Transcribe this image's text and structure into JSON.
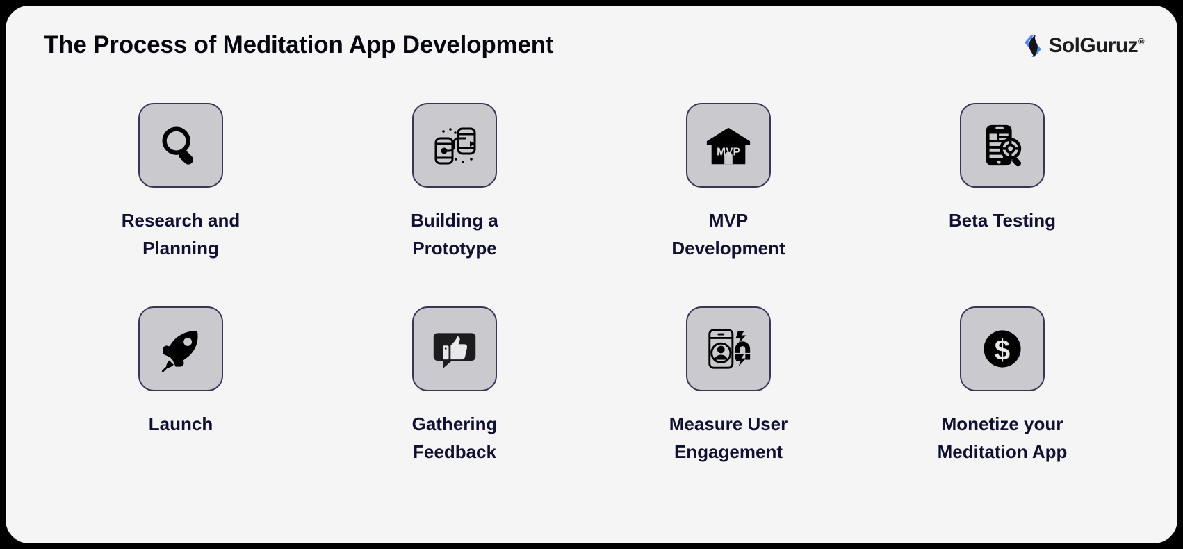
{
  "header": {
    "title": "The Process of Meditation App Development",
    "brand_name": "SolGuruz",
    "brand_registered_mark": "®",
    "brand_mark_color_primary": "#4a86f7",
    "brand_mark_color_secondary": "#14141c"
  },
  "theme": {
    "page_background": "#000000",
    "card_background": "#f5f5f6",
    "tile_fill": "#c9c9ce",
    "tile_border": "#3c3357",
    "title_color": "#06060f",
    "label_color": "#101033",
    "icon_color": "#000000"
  },
  "steps": [
    {
      "index": 1,
      "label": "Research and\nPlanning",
      "icon": "magnifier-icon"
    },
    {
      "index": 2,
      "label": "Building a\nPrototype",
      "icon": "prototype-phones-icon"
    },
    {
      "index": 3,
      "label": "MVP\nDevelopment",
      "icon": "mvp-house-icon",
      "icon_text": "MVP"
    },
    {
      "index": 4,
      "label": "Beta Testing",
      "icon": "phone-gear-magnifier-icon"
    },
    {
      "index": 5,
      "label": "Launch",
      "icon": "rocket-icon"
    },
    {
      "index": 6,
      "label": "Gathering\nFeedback",
      "icon": "thumbs-up-speech-bubble-icon"
    },
    {
      "index": 7,
      "label": "Measure User\nEngagement",
      "icon": "phone-user-magnet-icon"
    },
    {
      "index": 8,
      "label": "Monetize your\nMeditation App",
      "icon": "dollar-circle-icon"
    }
  ]
}
